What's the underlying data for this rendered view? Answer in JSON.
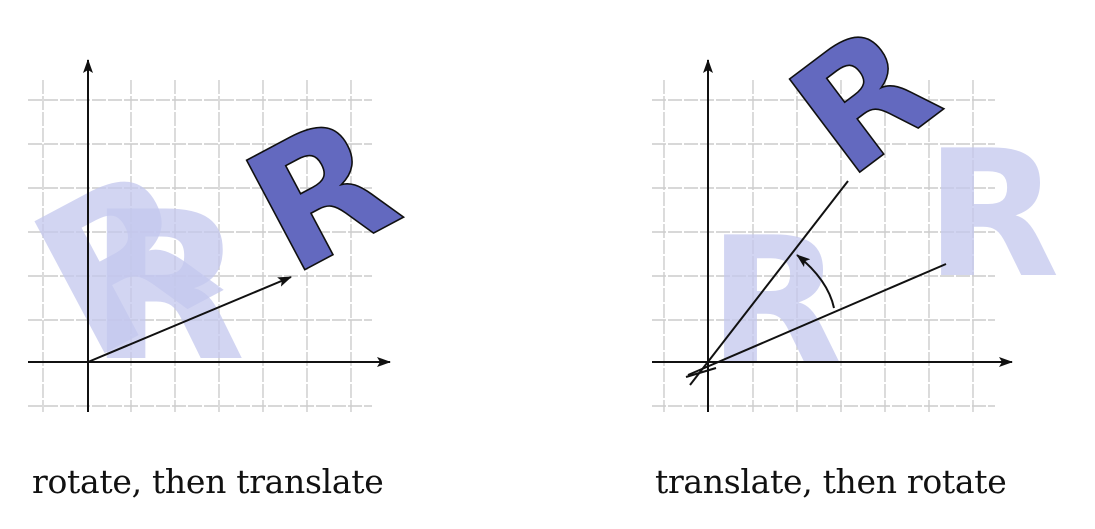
{
  "captions": {
    "left": "rotate, then translate",
    "right": "translate, then rotate"
  },
  "colors": {
    "grid": "#cccccc",
    "axis": "#111111",
    "ghost_letter": "#c4c8ee",
    "solid_letter": "#6369bf"
  },
  "figures": {
    "left": {
      "letter": "R",
      "operations": [
        "rotate",
        "translate"
      ]
    },
    "right": {
      "letter": "R",
      "operations": [
        "translate",
        "rotate"
      ]
    }
  }
}
